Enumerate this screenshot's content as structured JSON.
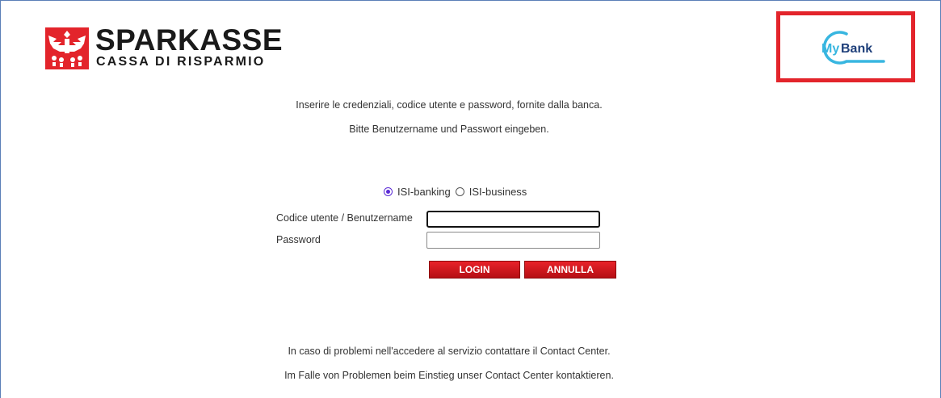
{
  "header": {
    "brand_name": "SPARKASSE",
    "brand_subtitle": "CASSA DI RISPARMIO",
    "partner_logo_text_my": "My",
    "partner_logo_text_bank": "Bank"
  },
  "intro": {
    "line_it": "Inserire le credenziali, codice utente e password, fornite dalla banca.",
    "line_de": "Bitte Benutzername und Passwort eingeben."
  },
  "login_type": {
    "options": [
      {
        "label": "ISI-banking",
        "checked": true
      },
      {
        "label": "ISI-business",
        "checked": false
      }
    ]
  },
  "form": {
    "username_label": "Codice utente / Benutzername",
    "username_value": "",
    "password_label": "Password",
    "password_value": "",
    "login_button": "LOGIN",
    "cancel_button": "ANNULLA"
  },
  "footer": {
    "line_it": "In caso di problemi nell'accedere al servizio contattare il Contact Center.",
    "line_de": "Im Falle von Problemen beim Einstieg unser Contact Center kontaktieren."
  },
  "colors": {
    "brand_red": "#e3242b",
    "button_red": "#c8161c",
    "mybank_blue": "#1e5aa8",
    "mybank_cyan": "#38b6e0",
    "radio_accent": "#5b2bd6"
  },
  "icons": {
    "brand_mark": "sparkasse-eagle-icon",
    "partner_logo": "mybank-logo",
    "radio_checked": "radio-checked-icon",
    "radio_unchecked": "radio-unchecked-icon"
  }
}
